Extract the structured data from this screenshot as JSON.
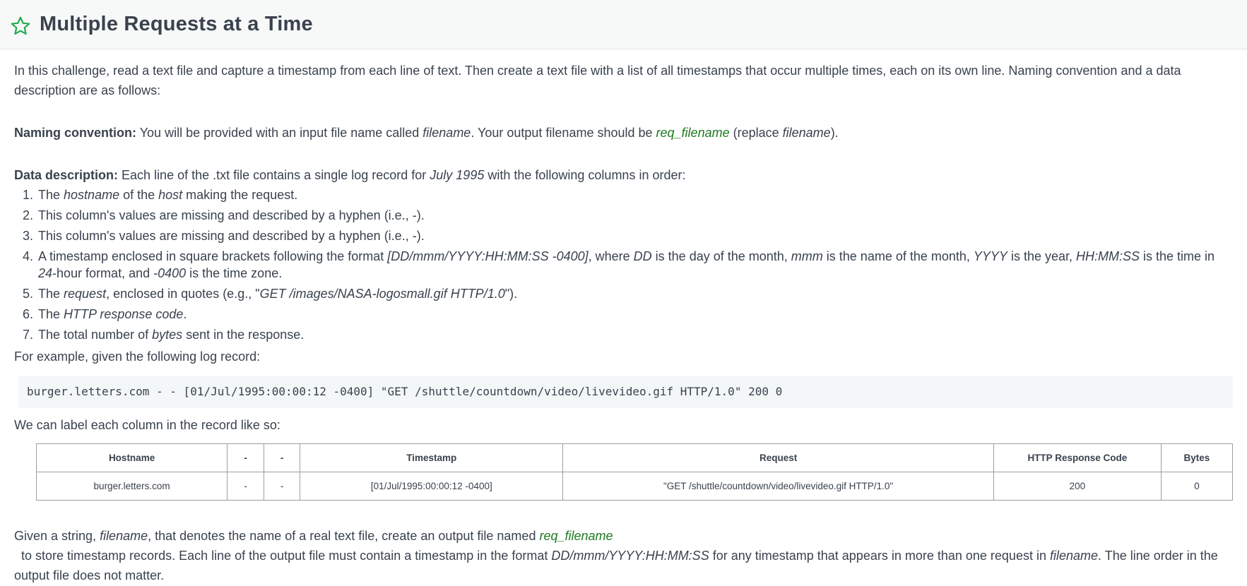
{
  "header": {
    "title": "Multiple Requests at a Time",
    "icon": "star-outline-icon",
    "icon_color": "#1ba94c"
  },
  "intro": "In this challenge, read a text file and capture a timestamp from each line of text. Then create a text file with a list of all timestamps that occur multiple times, each on its own line. Naming convention and a data description are as follows:",
  "naming": {
    "label": "Naming convention:",
    "t1": " You will be provided with an input file name called ",
    "filename": "filename",
    "t2": ". Your output filename should be ",
    "req_filename": "req_filename",
    "t3": " (replace ",
    "filename2": "filename",
    "t4": ")."
  },
  "data_description": {
    "label": "Data description:",
    "t1": " Each line of the .txt file contains a single log record for ",
    "month": "July 1995",
    "t2": " with the following columns in order:"
  },
  "columns_list": {
    "item1": {
      "a": "The ",
      "b": "hostname",
      "c": " of the ",
      "d": "host",
      "e": " making the request."
    },
    "item2": "This column's values are missing and described by a hyphen (i.e., -).",
    "item3": "This column's values are missing and described by a hyphen (i.e., -).",
    "item4": {
      "a": "A timestamp enclosed in square brackets following the format ",
      "b": "[DD/mmm/YYYY:HH:MM:SS -0400]",
      "c": ", where ",
      "d": "DD",
      "e": " is the day of the month, ",
      "f": "mmm",
      "g": " is the name of the month, ",
      "h": "YYYY",
      "i": " is the year, ",
      "j": "HH:MM:SS",
      "k": " is the time in ",
      "l": "24",
      "m": "-hour format, and ",
      "n": "-0400",
      "o": " is the time zone."
    },
    "item5": {
      "a": "The ",
      "b": "request",
      "c": ", enclosed in quotes (e.g., \"",
      "d": "GET /images/NASA-logosmall.gif HTTP/1.0",
      "e": "\")."
    },
    "item6": {
      "a": "The ",
      "b": "HTTP response code",
      "c": "."
    },
    "item7": {
      "a": "The total number of ",
      "b": "bytes",
      "c": " sent in the response."
    }
  },
  "example_intro": "For example, given the following log record:",
  "example_record": "burger.letters.com - - [01/Jul/1995:00:00:12 -0400] \"GET /shuttle/countdown/video/livevideo.gif HTTP/1.0\" 200 0",
  "label_intro": "We can label each column in the record like so:",
  "table": {
    "headers": [
      "Hostname",
      "-",
      "-",
      "Timestamp",
      "Request",
      "HTTP Response Code",
      "Bytes"
    ],
    "row": [
      "burger.letters.com",
      "-",
      "-",
      "[01/Jul/1995:00:00:12 -0400]",
      "\"GET /shuttle/countdown/video/livevideo.gif HTTP/1.0\"",
      "200",
      "0"
    ]
  },
  "given": {
    "t1": "Given a string, ",
    "filename": "filename",
    "t2": ", that denotes the name of a real text file, create an output file named ",
    "req_filename": "req_filename",
    "t3": "  to store timestamp records. Each line of the output file must contain a timestamp in the format ",
    "format": "DD/mmm/YYYY:HH:MM:SS",
    "t4": " for any timestamp that appears in more than one request in ",
    "filename2": "filename",
    "t5": ". The line order in the output file does not matter."
  }
}
